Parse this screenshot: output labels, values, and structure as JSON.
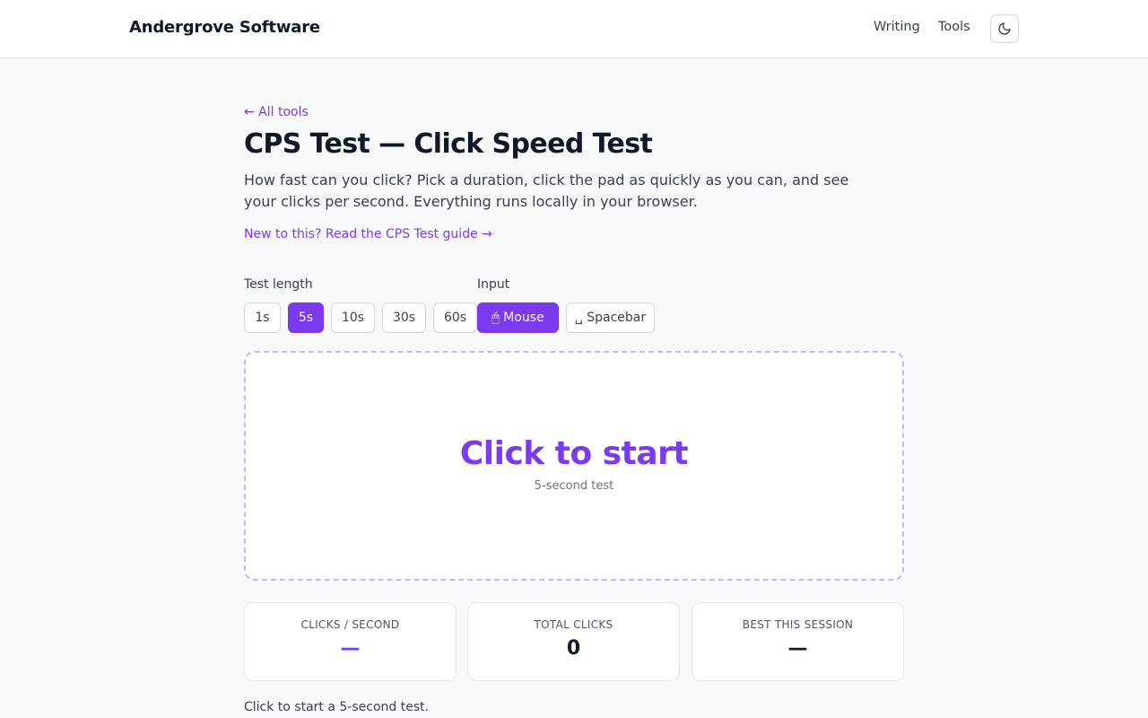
{
  "header": {
    "brand": "Andergrove Software",
    "nav": {
      "writing": "Writing",
      "tools": "Tools"
    },
    "theme_toggle_icon": "moon-icon"
  },
  "main": {
    "back_link": "← All tools",
    "title": "CPS Test — Click Speed Test",
    "description": "How fast can you click? Pick a duration, click the pad as quickly as you can, and see your clicks per second. Everything runs locally in your browser.",
    "guide_link": "New to this? Read the CPS Test guide →"
  },
  "controls": {
    "test_length": {
      "label": "Test length",
      "options": [
        "1s",
        "5s",
        "10s",
        "30s",
        "60s"
      ],
      "selected": "5s"
    },
    "input": {
      "label": "Input",
      "options": [
        {
          "icon": "mouse-icon",
          "label": "🖱 Mouse"
        },
        {
          "icon": "spacebar-icon",
          "label": "␣ Spacebar"
        }
      ],
      "selected": "Mouse"
    }
  },
  "pad": {
    "title": "Click to start",
    "subtitle": "5-second test"
  },
  "stats": {
    "cps": {
      "label": "CLICKS / SECOND",
      "value": "—"
    },
    "total": {
      "label": "TOTAL CLICKS",
      "value": "0"
    },
    "best": {
      "label": "BEST THIS SESSION",
      "value": "—"
    }
  },
  "status": "Click to start a 5-second test.",
  "colors": {
    "accent": "#7c3aed",
    "pad_border": "#c4b5fd"
  }
}
